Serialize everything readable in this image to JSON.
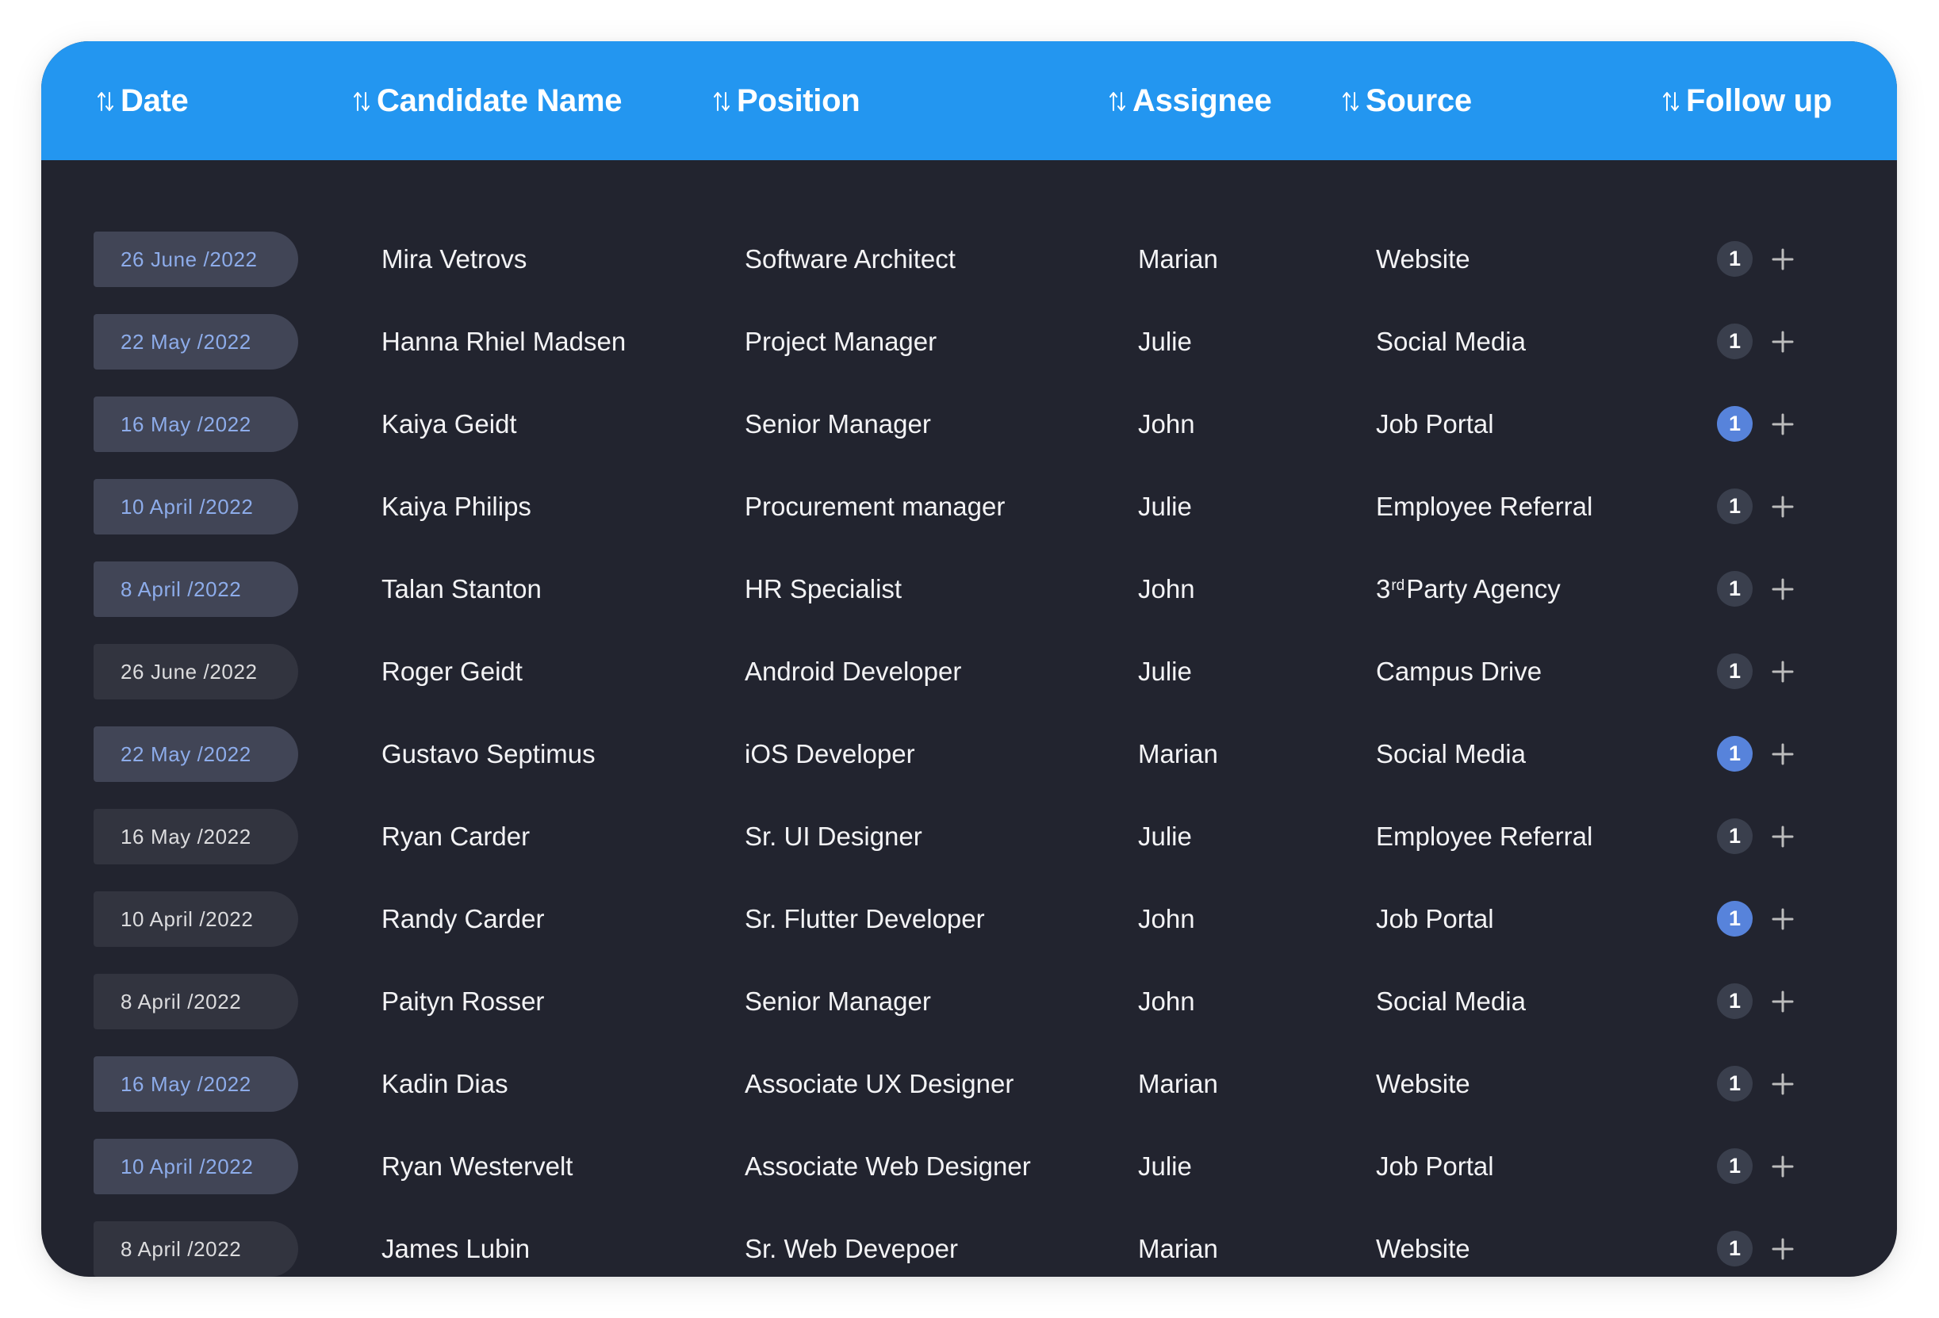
{
  "colors": {
    "header_bg": "#2396f0",
    "body_bg": "#22242f",
    "pill_highlight_bg": "#414556",
    "pill_highlight_text": "#8dacea",
    "pill_plain_bg": "#32343f",
    "pill_plain_text": "#dcdcde",
    "badge_grey": "#3a3f4d",
    "badge_blue": "#5783db",
    "plus_icon": "#bcbcbc"
  },
  "table": {
    "columns": [
      {
        "key": "date",
        "label": "Date",
        "icon": "sort-icon"
      },
      {
        "key": "candidate",
        "label": "Candidate Name",
        "icon": "sort-icon"
      },
      {
        "key": "position",
        "label": "Position",
        "icon": "sort-icon"
      },
      {
        "key": "assignee",
        "label": "Assignee",
        "icon": "sort-icon"
      },
      {
        "key": "source",
        "label": "Source",
        "icon": "sort-icon"
      },
      {
        "key": "follow_up",
        "label": "Follow up",
        "icon": "sort-icon"
      }
    ],
    "rows": [
      {
        "date": "26 June /2022",
        "date_style": "highlight",
        "candidate": "Mira Vetrovs",
        "position": "Software Architect",
        "assignee": "Marian",
        "source": "Website",
        "follow_up_count": "1",
        "follow_up_style": "grey",
        "add_icon": "plus-icon"
      },
      {
        "date": "22 May /2022",
        "date_style": "highlight",
        "candidate": "Hanna Rhiel Madsen",
        "position": "Project Manager",
        "assignee": "Julie",
        "source": "Social Media",
        "follow_up_count": "1",
        "follow_up_style": "grey",
        "add_icon": "plus-icon"
      },
      {
        "date": "16 May /2022",
        "date_style": "highlight",
        "candidate": "Kaiya Geidt",
        "position": "Senior Manager",
        "assignee": "John",
        "source": "Job Portal",
        "follow_up_count": "1",
        "follow_up_style": "blue",
        "add_icon": "plus-icon"
      },
      {
        "date": "10 April /2022",
        "date_style": "highlight",
        "candidate": "Kaiya Philips",
        "position": "Procurement manager",
        "assignee": "Julie",
        "source": "Employee Referral",
        "follow_up_count": "1",
        "follow_up_style": "grey",
        "add_icon": "plus-icon"
      },
      {
        "date": "8 April /2022",
        "date_style": "highlight",
        "candidate": "Talan Stanton",
        "position": "HR Specialist",
        "assignee": "John",
        "source": "3",
        "source_sup": "rd",
        "source_rest": "Party Agency",
        "follow_up_count": "1",
        "follow_up_style": "grey",
        "add_icon": "plus-icon"
      },
      {
        "date": "26 June /2022",
        "date_style": "plain",
        "candidate": "Roger Geidt",
        "position": "Android Developer",
        "assignee": "Julie",
        "source": "Campus Drive",
        "follow_up_count": "1",
        "follow_up_style": "grey",
        "add_icon": "plus-icon"
      },
      {
        "date": "22 May /2022",
        "date_style": "highlight",
        "candidate": "Gustavo Septimus",
        "position": "iOS Developer",
        "assignee": "Marian",
        "source": "Social Media",
        "follow_up_count": "1",
        "follow_up_style": "blue",
        "add_icon": "plus-icon"
      },
      {
        "date": "16 May /2022",
        "date_style": "plain",
        "candidate": "Ryan Carder",
        "position": "Sr. UI Designer",
        "assignee": "Julie",
        "source": "Employee Referral",
        "follow_up_count": "1",
        "follow_up_style": "grey",
        "add_icon": "plus-icon"
      },
      {
        "date": "10 April /2022",
        "date_style": "plain",
        "candidate": "Randy Carder",
        "position": "Sr. Flutter Developer",
        "assignee": "John",
        "source": "Job Portal",
        "follow_up_count": "1",
        "follow_up_style": "blue",
        "add_icon": "plus-icon"
      },
      {
        "date": "8 April /2022",
        "date_style": "plain",
        "candidate": "Paityn Rosser",
        "position": "Senior Manager",
        "assignee": "John",
        "source": "Social Media",
        "follow_up_count": "1",
        "follow_up_style": "grey",
        "add_icon": "plus-icon"
      },
      {
        "date": "16 May /2022",
        "date_style": "highlight",
        "candidate": "Kadin Dias",
        "position": "Associate UX Designer",
        "assignee": "Marian",
        "source": "Website",
        "follow_up_count": "1",
        "follow_up_style": "grey",
        "add_icon": "plus-icon"
      },
      {
        "date": "10 April /2022",
        "date_style": "highlight",
        "candidate": "Ryan Westervelt",
        "position": "Associate Web Designer",
        "assignee": "Julie",
        "source": "Job Portal",
        "follow_up_count": "1",
        "follow_up_style": "grey",
        "add_icon": "plus-icon"
      },
      {
        "date": "8 April /2022",
        "date_style": "plain",
        "candidate": "James Lubin",
        "position": "Sr. Web Devepoer",
        "assignee": "Marian",
        "source": "Website",
        "follow_up_count": "1",
        "follow_up_style": "grey",
        "add_icon": "plus-icon"
      }
    ]
  }
}
